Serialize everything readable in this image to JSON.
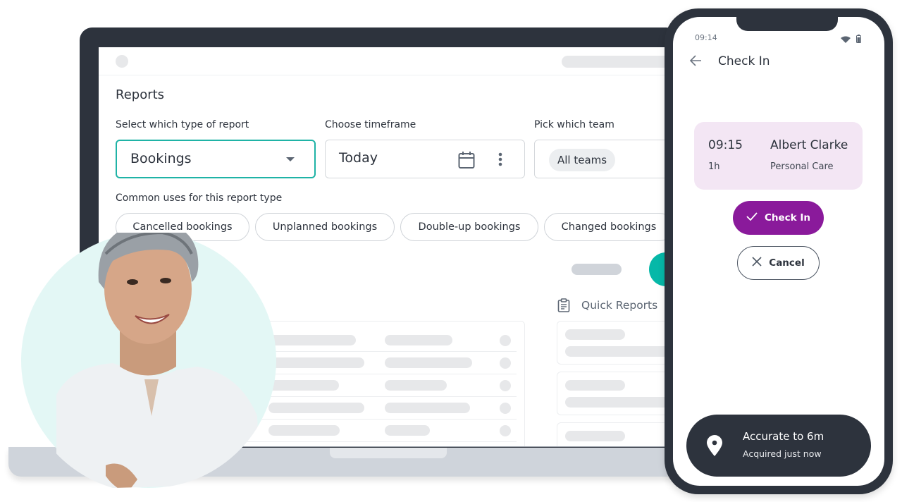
{
  "reports": {
    "title": "Reports",
    "report_type": {
      "label": "Select which type of report",
      "value": "Bookings"
    },
    "timeframe": {
      "label": "Choose timeframe",
      "value": "Today"
    },
    "team": {
      "label": "Pick which team",
      "value": "All teams"
    },
    "common_uses": {
      "label": "Common uses for this report type",
      "chips": [
        {
          "label": "Cancelled bookings"
        },
        {
          "label": "Unplanned bookings"
        },
        {
          "label": "Double-up bookings"
        },
        {
          "label": "Changed bookings"
        }
      ]
    },
    "quick_reports": {
      "title": "Quick Reports"
    }
  },
  "phone": {
    "status_time": "09:14",
    "title": "Check In",
    "booking": {
      "time": "09:15",
      "duration": "1h",
      "client": "Albert Clarke",
      "service": "Personal Care"
    },
    "checkin_label": "Check In",
    "cancel_label": "Cancel",
    "location": {
      "title": "Accurate to 6m",
      "subtitle": "Acquired just now"
    }
  },
  "colors": {
    "accent_teal": "#1fb3a6",
    "primary_purple": "#8a1a9b",
    "dark": "#2d333d",
    "card_lilac": "#f3e6f4"
  }
}
